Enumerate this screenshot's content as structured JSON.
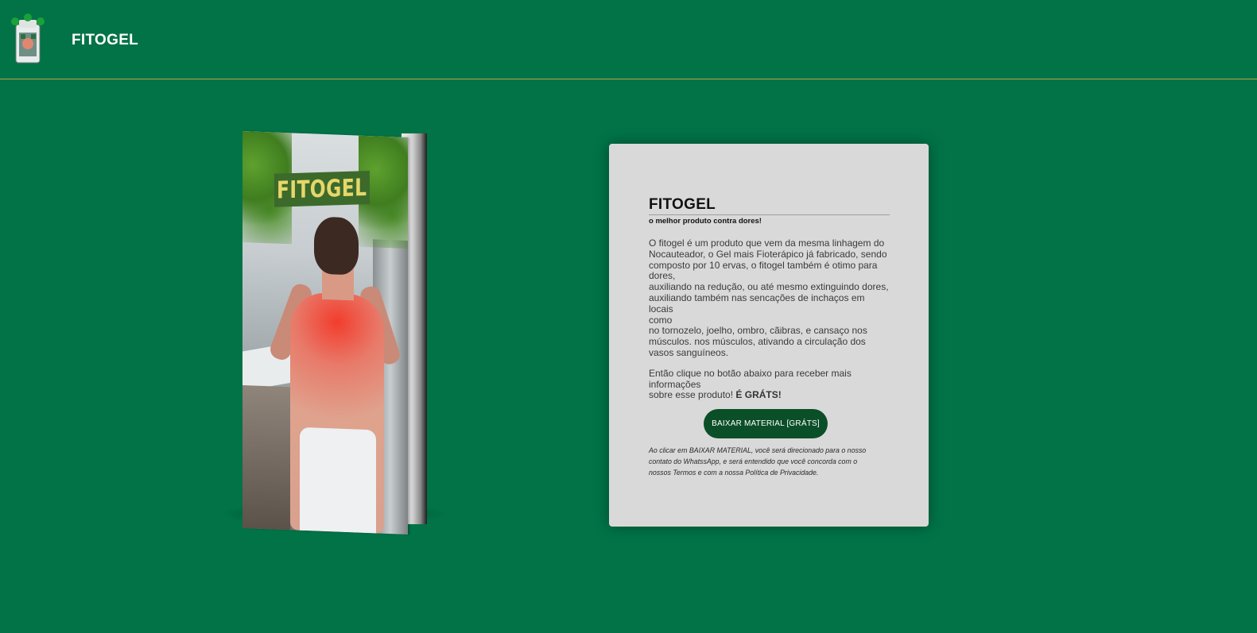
{
  "header": {
    "brand": "FITOGEL",
    "logo_icon": "product-jar-logo-icon"
  },
  "book": {
    "cover_title": "FITOGEL",
    "cover_icon": "ebook-cover-image"
  },
  "card": {
    "title": "FITOGEL",
    "subtitle": "o melhor produto contra dores!",
    "paragraph_lines": [
      "O fitogel é um produto que vem da mesma linhagem do",
      "Nocauteador, o Gel mais Fioterápico já fabricado, sendo",
      "composto por 10 ervas, o fitogel também é otimo para",
      "dores,",
      "auxiliando na redução, ou até mesmo extinguindo dores,",
      "auxiliando também nas sencações de inchaços em locais",
      "como",
      "no tornozelo, joelho, ombro, cãibras, e cansaço nos",
      "músculos. nos músculos, ativando a circulação dos",
      "vasos sanguíneos."
    ],
    "cta_lines": [
      "Então clique no botão abaixo para receber mais",
      "informações"
    ],
    "cta_last_prefix": "sobre esse produto! ",
    "cta_last_bold": "É GRÁTS!",
    "button_label": "BAIXAR MATERIAL [GRÁTS]",
    "disclaimer_lines": [
      "Ao clicar em BAIXAR MATERIAL, você será direcionado para o nosso",
      "contato do WhatssApp, e será entendido que você concorda com o",
      "nossos Termos e com a nossa Política de Privacidade."
    ]
  },
  "colors": {
    "background": "#017347",
    "header_border": "#b8a24a",
    "card_bg": "#d9d9d9",
    "button_bg": "#0b4f28"
  }
}
